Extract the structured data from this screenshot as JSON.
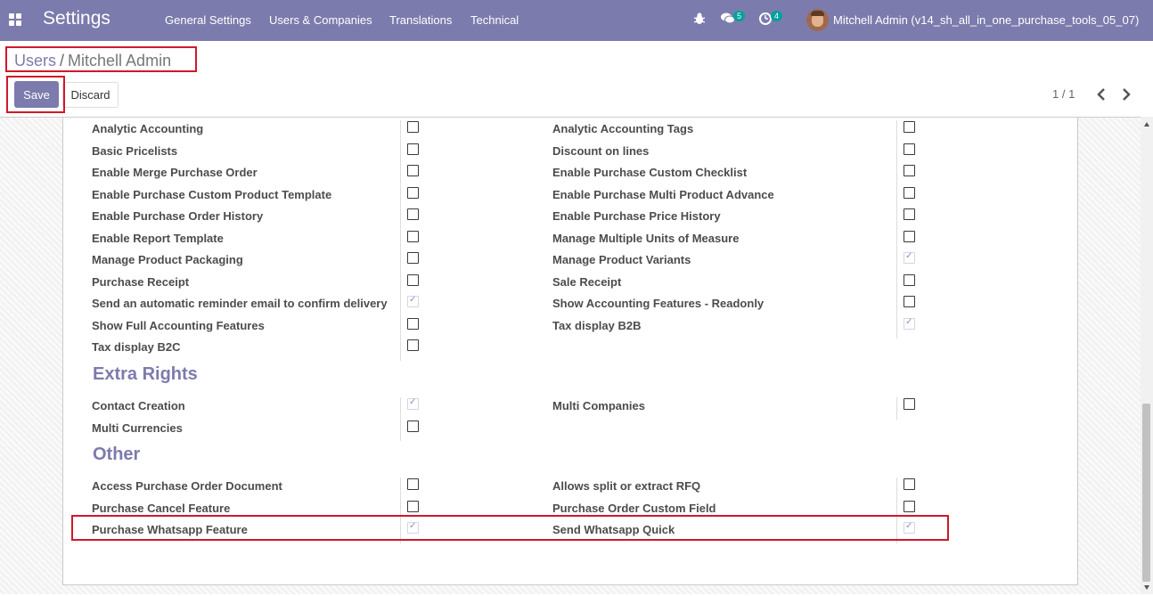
{
  "navbar": {
    "app_title": "Settings",
    "menu": [
      "General Settings",
      "Users & Companies",
      "Translations",
      "Technical"
    ],
    "messages_count": "5",
    "activities_count": "4",
    "user_name": "Mitchell Admin (v14_sh_all_in_one_purchase_tools_05_07)"
  },
  "breadcrumb": {
    "parent": "Users",
    "separator": "/",
    "current": "Mitchell Admin"
  },
  "buttons": {
    "save": "Save",
    "discard": "Discard"
  },
  "pager": {
    "value": "1 / 1"
  },
  "colors": {
    "brand": "#7c7bad",
    "badge": "#00a09d",
    "highlight": "#d0182b"
  },
  "technical_rows": [
    {
      "left": "Analytic Accounting",
      "left_checked": false,
      "right": "Analytic Accounting Tags",
      "right_checked": false
    },
    {
      "left": "Basic Pricelists",
      "left_checked": false,
      "right": "Discount on lines",
      "right_checked": false
    },
    {
      "left": "Enable Merge Purchase Order",
      "left_checked": false,
      "right": "Enable Purchase Custom Checklist",
      "right_checked": false
    },
    {
      "left": "Enable Purchase Custom Product Template",
      "left_checked": false,
      "right": "Enable Purchase Multi Product Advance",
      "right_checked": false
    },
    {
      "left": "Enable Purchase Order History",
      "left_checked": false,
      "right": "Enable Purchase Price History",
      "right_checked": false
    },
    {
      "left": "Enable Report Template",
      "left_checked": false,
      "right": "Manage Multiple Units of Measure",
      "right_checked": false
    },
    {
      "left": "Manage Product Packaging",
      "left_checked": false,
      "right": "Manage Product Variants",
      "right_checked": true
    },
    {
      "left": "Purchase Receipt",
      "left_checked": false,
      "right": "Sale Receipt",
      "right_checked": false
    },
    {
      "left": "Send an automatic reminder email to confirm delivery",
      "left_checked": true,
      "right": "Show Accounting Features - Readonly",
      "right_checked": false
    },
    {
      "left": "Show Full Accounting Features",
      "left_checked": false,
      "right": "Tax display B2B",
      "right_checked": true
    },
    {
      "left": "Tax display B2C",
      "left_checked": false,
      "right": null,
      "right_checked": null
    }
  ],
  "extra_rights": {
    "title": "Extra Rights",
    "rows": [
      {
        "left": "Contact Creation",
        "left_checked": true,
        "right": "Multi Companies",
        "right_checked": false
      },
      {
        "left": "Multi Currencies",
        "left_checked": false,
        "right": null,
        "right_checked": null
      }
    ]
  },
  "other": {
    "title": "Other",
    "rows": [
      {
        "left": "Access Purchase Order Document",
        "left_checked": false,
        "right": "Allows split or extract RFQ",
        "right_checked": false
      },
      {
        "left": "Purchase Cancel Feature",
        "left_checked": false,
        "right": "Purchase Order Custom Field",
        "right_checked": false
      },
      {
        "left": "Purchase Whatsapp Feature",
        "left_checked": true,
        "right": "Send Whatsapp Quick",
        "right_checked": true
      }
    ]
  }
}
